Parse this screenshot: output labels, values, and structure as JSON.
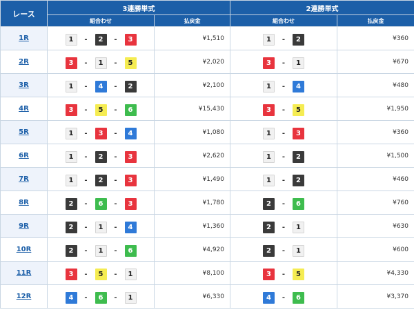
{
  "header": {
    "race": "レース",
    "trifecta": "3連勝単式",
    "exacta": "2連勝単式",
    "combination": "組合わせ",
    "payout": "払戻金"
  },
  "colors": {
    "1": "#f1f1f1",
    "2": "#3a3a3a",
    "3": "#e8343e",
    "4": "#2f7ad8",
    "5": "#f5ec52",
    "6": "#3ebc4e",
    "header": "#1c5fa8"
  },
  "separator": "-",
  "rows": [
    {
      "race": "1R",
      "tri": [
        "1",
        "2",
        "3"
      ],
      "tri_pay": "¥1,510",
      "ex": [
        "1",
        "2"
      ],
      "ex_pay": "¥360"
    },
    {
      "race": "2R",
      "tri": [
        "3",
        "1",
        "5"
      ],
      "tri_pay": "¥2,020",
      "ex": [
        "3",
        "1"
      ],
      "ex_pay": "¥670"
    },
    {
      "race": "3R",
      "tri": [
        "1",
        "4",
        "2"
      ],
      "tri_pay": "¥2,100",
      "ex": [
        "1",
        "4"
      ],
      "ex_pay": "¥480"
    },
    {
      "race": "4R",
      "tri": [
        "3",
        "5",
        "6"
      ],
      "tri_pay": "¥15,430",
      "ex": [
        "3",
        "5"
      ],
      "ex_pay": "¥1,950"
    },
    {
      "race": "5R",
      "tri": [
        "1",
        "3",
        "4"
      ],
      "tri_pay": "¥1,080",
      "ex": [
        "1",
        "3"
      ],
      "ex_pay": "¥360"
    },
    {
      "race": "6R",
      "tri": [
        "1",
        "2",
        "3"
      ],
      "tri_pay": "¥2,620",
      "ex": [
        "1",
        "2"
      ],
      "ex_pay": "¥1,500"
    },
    {
      "race": "7R",
      "tri": [
        "1",
        "2",
        "3"
      ],
      "tri_pay": "¥1,490",
      "ex": [
        "1",
        "2"
      ],
      "ex_pay": "¥460"
    },
    {
      "race": "8R",
      "tri": [
        "2",
        "6",
        "3"
      ],
      "tri_pay": "¥1,780",
      "ex": [
        "2",
        "6"
      ],
      "ex_pay": "¥760"
    },
    {
      "race": "9R",
      "tri": [
        "2",
        "1",
        "4"
      ],
      "tri_pay": "¥1,360",
      "ex": [
        "2",
        "1"
      ],
      "ex_pay": "¥630"
    },
    {
      "race": "10R",
      "tri": [
        "2",
        "1",
        "6"
      ],
      "tri_pay": "¥4,920",
      "ex": [
        "2",
        "1"
      ],
      "ex_pay": "¥600"
    },
    {
      "race": "11R",
      "tri": [
        "3",
        "5",
        "1"
      ],
      "tri_pay": "¥8,100",
      "ex": [
        "3",
        "5"
      ],
      "ex_pay": "¥4,330"
    },
    {
      "race": "12R",
      "tri": [
        "4",
        "6",
        "1"
      ],
      "tri_pay": "¥6,330",
      "ex": [
        "4",
        "6"
      ],
      "ex_pay": "¥3,370"
    }
  ]
}
